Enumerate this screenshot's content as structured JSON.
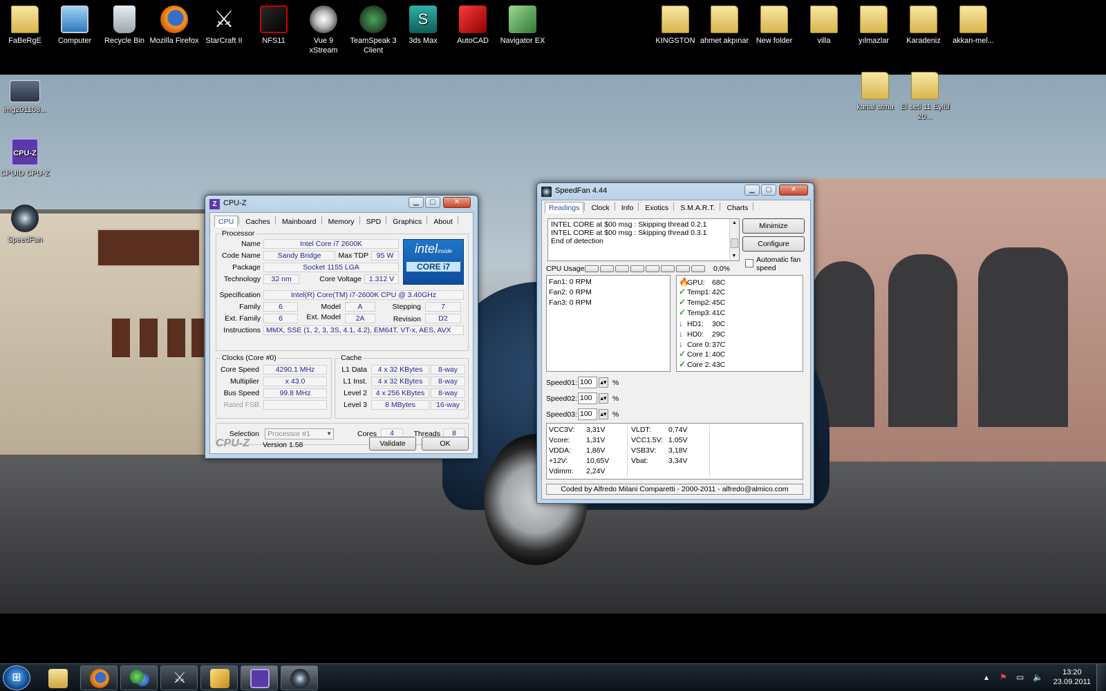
{
  "desktop": {
    "top_icons": [
      {
        "label": "FaBeRgE",
        "icon": "user-folder-icon"
      },
      {
        "label": "Computer",
        "icon": "computer-icon"
      },
      {
        "label": "Recycle Bin",
        "icon": "recycle-bin-icon"
      },
      {
        "label": "Mozilla Firefox",
        "icon": "firefox-icon"
      },
      {
        "label": "StarCraft II",
        "icon": "starcraft-icon"
      },
      {
        "label": "NFS11",
        "icon": "nfs-icon"
      },
      {
        "label": "Vue 9 xStream",
        "icon": "vue-icon"
      },
      {
        "label": "TeamSpeak 3 Client",
        "icon": "teamspeak-icon"
      },
      {
        "label": "3ds Max",
        "icon": "3dsmax-icon"
      },
      {
        "label": "AutoCAD",
        "icon": "autocad-icon"
      },
      {
        "label": "Navigator EX",
        "icon": "navigator-icon"
      },
      {
        "label": "KINGSTON",
        "icon": "folder-icon"
      },
      {
        "label": "ahmet akpınar",
        "icon": "folder-icon"
      },
      {
        "label": "New folder",
        "icon": "folder-icon"
      },
      {
        "label": "villa",
        "icon": "folder-icon"
      },
      {
        "label": "yılmazlar",
        "icon": "folder-icon"
      },
      {
        "label": "Karadeniz",
        "icon": "folder-icon"
      },
      {
        "label": "akkan-mel...",
        "icon": "folder-icon"
      }
    ],
    "left_icons": [
      {
        "label": "img201108...",
        "icon": "image-icon"
      },
      {
        "label": "CPUID CPU-Z",
        "icon": "cpuz-icon"
      },
      {
        "label": "SpeedFan",
        "icon": "speedfan-icon"
      }
    ],
    "right_icons": [
      {
        "label": "kanal atma",
        "icon": "folder-icon"
      },
      {
        "label": "El seti 11 Eylül 20...",
        "icon": "folder-icon"
      }
    ]
  },
  "cpuz": {
    "title": "CPU-Z",
    "tabs": [
      "CPU",
      "Caches",
      "Mainboard",
      "Memory",
      "SPD",
      "Graphics",
      "About"
    ],
    "active_tab": "CPU",
    "processor": {
      "group_label": "Processor",
      "name_label": "Name",
      "name": "Intel Core i7 2600K",
      "codename_label": "Code Name",
      "codename": "Sandy Bridge",
      "maxtdp_label": "Max TDP",
      "maxtdp": "95 W",
      "package_label": "Package",
      "package": "Socket 1155 LGA",
      "technology_label": "Technology",
      "technology": "32 nm",
      "corevoltage_label": "Core Voltage",
      "corevoltage": "1.312 V",
      "spec_label": "Specification",
      "spec": "Intel(R) Core(TM) i7-2600K CPU @ 3.40GHz",
      "family_label": "Family",
      "family": "6",
      "model_label": "Model",
      "model": "A",
      "stepping_label": "Stepping",
      "stepping": "7",
      "extfamily_label": "Ext. Family",
      "extfamily": "6",
      "extmodel_label": "Ext. Model",
      "extmodel": "2A",
      "revision_label": "Revision",
      "revision": "D2",
      "instructions_label": "Instructions",
      "instructions": "MMX, SSE (1, 2, 3, 3S, 4.1, 4.2), EM64T, VT-x, AES, AVX",
      "logo_inside": "inside",
      "logo_brand": "intel",
      "logo_core": "CORE i7"
    },
    "clocks": {
      "group_label": "Clocks (Core #0)",
      "corespeed_label": "Core Speed",
      "corespeed": "4290.1 MHz",
      "multiplier_label": "Multiplier",
      "multiplier": "x 43.0",
      "busspeed_label": "Bus Speed",
      "busspeed": "99.8 MHz",
      "ratedfsb_label": "Rated FSB",
      "ratedfsb": ""
    },
    "cache": {
      "group_label": "Cache",
      "rows": [
        {
          "label": "L1 Data",
          "size": "4 x 32 KBytes",
          "way": "8-way"
        },
        {
          "label": "L1 Inst.",
          "size": "4 x 32 KBytes",
          "way": "8-way"
        },
        {
          "label": "Level 2",
          "size": "4 x 256 KBytes",
          "way": "8-way"
        },
        {
          "label": "Level 3",
          "size": "8 MBytes",
          "way": "16-way"
        }
      ]
    },
    "selection_label": "Selection",
    "selection": "Processor #1",
    "cores_label": "Cores",
    "cores": "4",
    "threads_label": "Threads",
    "threads": "8",
    "brand": "CPU-Z",
    "version": "Version 1.58",
    "validate_label": "Validate",
    "ok_label": "OK"
  },
  "speedfan": {
    "title": "SpeedFan 4.44",
    "tabs": [
      "Readings",
      "Clock",
      "Info",
      "Exotics",
      "S.M.A.R.T.",
      "Charts"
    ],
    "active_tab": "Readings",
    "log_lines": [
      "INTEL CORE at $00 msg : Skipping thread 0.2.1",
      "INTEL CORE at $00 msg : Skipping thread 0.3.1",
      "End of detection"
    ],
    "minimize_label": "Minimize",
    "configure_label": "Configure",
    "auto_fan_label": "Automatic fan speed",
    "auto_fan_checked": false,
    "cpu_usage_label": "CPU Usage",
    "cpu_usage_value": "0,0%",
    "fans": [
      "Fan1: 0 RPM",
      "Fan2: 0 RPM",
      "Fan3: 0 RPM"
    ],
    "temps": [
      {
        "label": "GPU:",
        "value": "68C",
        "status": "hot"
      },
      {
        "label": "Temp1:",
        "value": "42C",
        "status": "ok"
      },
      {
        "label": "Temp2:",
        "value": "45C",
        "status": "ok"
      },
      {
        "label": "Temp3:",
        "value": "41C",
        "status": "ok"
      },
      {
        "label": "HD1:",
        "value": "30C",
        "status": "down"
      },
      {
        "label": "HD0:",
        "value": "29C",
        "status": "down"
      },
      {
        "label": "Core 0:",
        "value": "37C",
        "status": "down"
      },
      {
        "label": "Core 1:",
        "value": "40C",
        "status": "ok"
      },
      {
        "label": "Core 2:",
        "value": "43C",
        "status": "ok"
      }
    ],
    "speeds": [
      {
        "label": "Speed01:",
        "value": "100",
        "unit": "%"
      },
      {
        "label": "Speed02:",
        "value": "100",
        "unit": "%"
      },
      {
        "label": "Speed03:",
        "value": "100",
        "unit": "%"
      }
    ],
    "voltages_left": [
      {
        "label": "VCC3V:",
        "value": "3,31V"
      },
      {
        "label": "Vcore:",
        "value": "1,31V"
      },
      {
        "label": "VDDA:",
        "value": "1,86V"
      },
      {
        "label": "+12V:",
        "value": "10,65V"
      },
      {
        "label": "Vdimm:",
        "value": "2,24V"
      }
    ],
    "voltages_right": [
      {
        "label": "VLDT:",
        "value": "0,74V"
      },
      {
        "label": "VCC1.5V:",
        "value": "1,05V"
      },
      {
        "label": "VSB3V:",
        "value": "3,18V"
      },
      {
        "label": "Vbat:",
        "value": "3,34V"
      }
    ],
    "footer": "Coded by Alfredo Milani Comparetti - 2000-2011 - alfredo@almico.com"
  },
  "taskbar": {
    "items": [
      "explorer-icon",
      "firefox-icon",
      "messenger-icon",
      "starcraft-icon",
      "autocad-icon",
      "cpuz-icon",
      "speedfan-icon"
    ],
    "time": "13:20",
    "date": "23.09.2011"
  }
}
